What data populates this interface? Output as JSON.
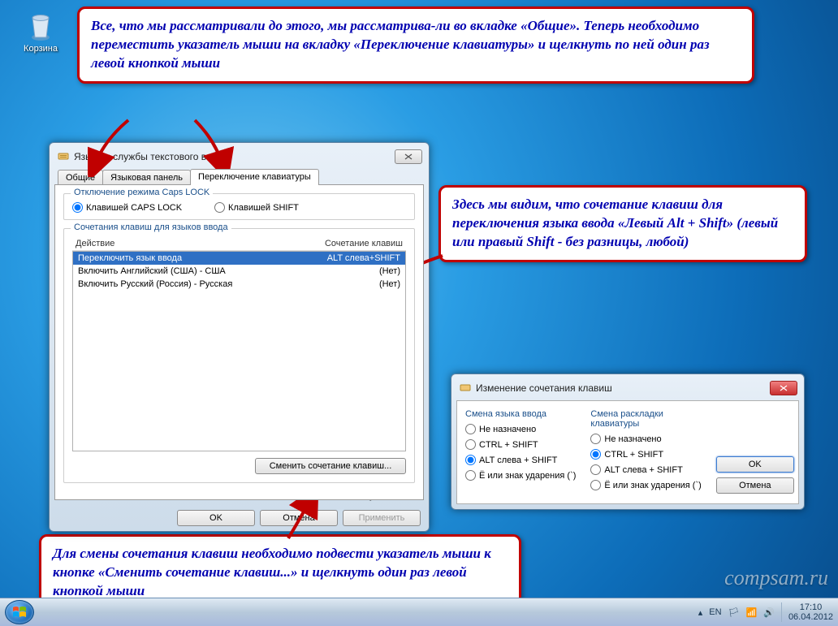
{
  "desktop": {
    "recycle_label": "Корзина"
  },
  "callouts": {
    "top": "Все, что мы рассматривали до этого, мы рассматрива-ли во вкладке «Общие». Теперь необходимо переместить указатель мыши на вкладку «Переключение клавиатуры» и щелкнуть по ней один раз левой кнопкой мыши",
    "right": "Здесь мы видим, что сочетание клавиш для переключения языка ввода «Левый Alt + Shift» (левый или правый Shift - без разницы, любой)",
    "bottom": "Для смены сочетания клавиш необходимо подвести указатель мыши к кнопке «Сменить сочетание клавиш...» и щелкнуть один раз левой кнопкой мыши"
  },
  "dialog1": {
    "title": "Языки и службы текстового ввода",
    "tabs": {
      "general": "Общие",
      "langbar": "Языковая панель",
      "switch": "Переключение клавиатуры"
    },
    "caps_group": "Отключение режима Caps LOCK",
    "caps_opt1": "Клавишей CAPS LOCK",
    "caps_opt2": "Клавишей SHIFT",
    "combo_group": "Сочетания клавиш для языков ввода",
    "col_action": "Действие",
    "col_combo": "Сочетание клавиш",
    "rows": [
      {
        "action": "Переключить язык ввода",
        "combo": "ALT слева+SHIFT"
      },
      {
        "action": "Включить Английский (США) - США",
        "combo": "(Нет)"
      },
      {
        "action": "Включить Русский (Россия) - Русская",
        "combo": "(Нет)"
      }
    ],
    "change_btn": "Сменить сочетание клавиш...",
    "ok": "OK",
    "cancel": "Отмена",
    "apply": "Применить"
  },
  "dialog2": {
    "title": "Изменение сочетания клавиш",
    "col1_hdr": "Смена языка ввода",
    "col2_hdr": "Смена раскладки клавиатуры",
    "opt_none": "Не назначено",
    "opt_ctrlshift": "CTRL + SHIFT",
    "opt_altshift": "ALT слева + SHIFT",
    "opt_grave": "Ё или знак ударения (`)",
    "ok": "OK",
    "cancel": "Отмена"
  },
  "taskbar": {
    "lang": "EN",
    "time": "17:10",
    "date": "06.04.2012"
  },
  "watermark": "compsam.ru"
}
